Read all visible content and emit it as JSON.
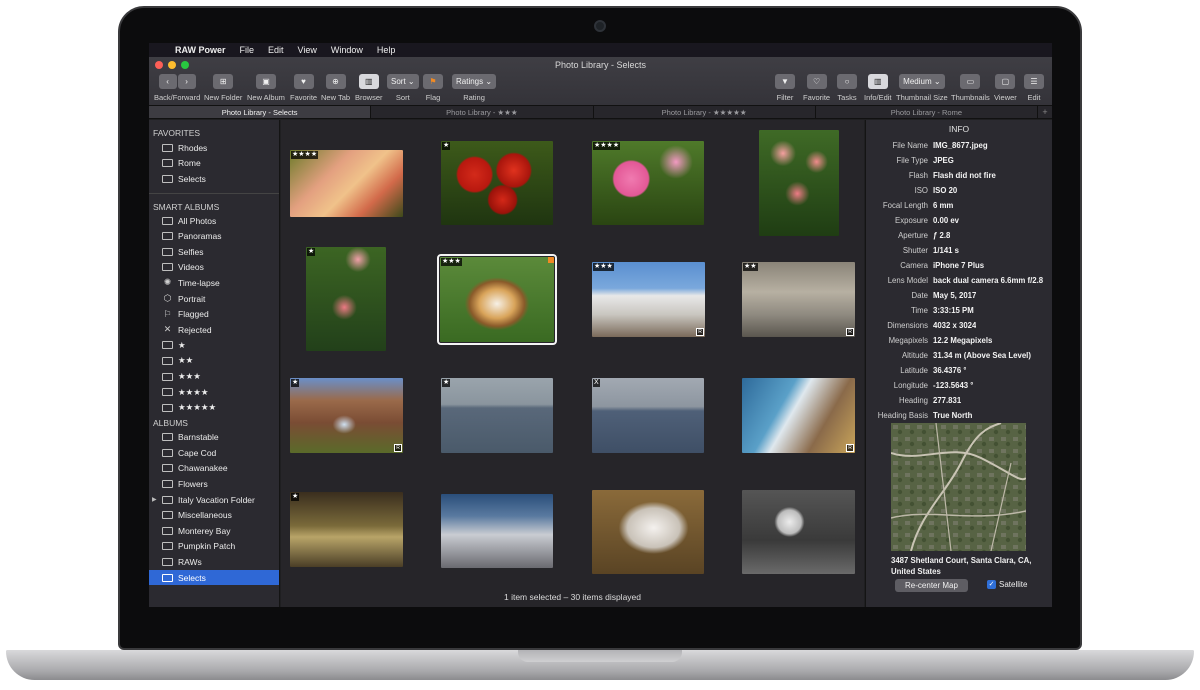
{
  "menubar": {
    "apple": "",
    "app_name": "RAW Power",
    "items": [
      "File",
      "Edit",
      "View",
      "Window",
      "Help"
    ]
  },
  "window": {
    "title": "Photo Library - Selects"
  },
  "toolbar": {
    "back_forward": "Back/Forward",
    "new_folder": "New Folder",
    "new_album": "New Album",
    "favorite": "Favorite",
    "new_tab": "New Tab",
    "browser": "Browser",
    "sort_value": "Sort",
    "sort": "Sort",
    "flag": "Flag",
    "rating_value": "Ratings",
    "rating": "Rating",
    "filter": "Filter",
    "favorite_right": "Favorite",
    "tasks": "Tasks",
    "info_edit": "Info/Edit",
    "thumb_size_value": "Medium",
    "thumbnail_size": "Thumbnail Size",
    "thumbnails": "Thumbnails",
    "viewer": "Viewer",
    "edit": "Edit"
  },
  "tabs": [
    {
      "label": "Photo Library - Selects"
    },
    {
      "label": "Photo Library - ★★★"
    },
    {
      "label": "Photo Library - ★★★★★"
    },
    {
      "label": "Photo Library - Rome"
    }
  ],
  "sidebar": {
    "favorites_header": "FAVORITES",
    "favorites": [
      "Rhodes",
      "Rome",
      "Selects"
    ],
    "smart_header": "SMART ALBUMS",
    "smart": [
      "All Photos",
      "Panoramas",
      "Selfies",
      "Videos",
      "Time-lapse",
      "Portrait",
      "Flagged",
      "Rejected",
      "★",
      "★★",
      "★★★",
      "★★★★",
      "★★★★★"
    ],
    "albums_header": "ALBUMS",
    "albums": [
      "Barnstable",
      "Cape Cod",
      "Chawanakee",
      "Flowers",
      "Italy Vacation Folder",
      "Miscellaneous",
      "Monterey Bay",
      "Pumpkin Patch",
      "RAWs",
      "Selects"
    ]
  },
  "grid": {
    "thumb_badges": [
      "★★★★",
      "★",
      "★★★★",
      "",
      "★",
      "★★★",
      "★★★",
      "★★",
      "★",
      "★",
      "X",
      "",
      "★",
      "",
      "",
      ""
    ],
    "raw_label": "R",
    "status": "1 item selected – 30 items displayed"
  },
  "info": {
    "title": "INFO",
    "rows": [
      {
        "k": "File Name",
        "v": "IMG_8677.jpeg"
      },
      {
        "k": "File Type",
        "v": "JPEG"
      },
      {
        "k": "Flash",
        "v": "Flash did not fire"
      },
      {
        "k": "ISO",
        "v": "ISO 20"
      },
      {
        "k": "Focal Length",
        "v": "6 mm"
      },
      {
        "k": "Exposure",
        "v": "0.00 ev"
      },
      {
        "k": "Aperture",
        "v": "ƒ 2.8"
      },
      {
        "k": "Shutter",
        "v": "1/141 s"
      },
      {
        "k": "Camera",
        "v": "iPhone 7 Plus"
      },
      {
        "k": "Lens Model",
        "v": "back dual camera 6.6mm f/2.8"
      },
      {
        "k": "Date",
        "v": "May 5, 2017"
      },
      {
        "k": "Time",
        "v": "3:33:15 PM"
      },
      {
        "k": "Dimensions",
        "v": "4032 x 3024"
      },
      {
        "k": "Megapixels",
        "v": "12.2 Megapixels"
      },
      {
        "k": "Altitude",
        "v": "31.34 m (Above Sea Level)"
      },
      {
        "k": "Latitude",
        "v": "36.4376 °"
      },
      {
        "k": "Longitude",
        "v": "-123.5643 °"
      },
      {
        "k": "Heading",
        "v": "277.831"
      },
      {
        "k": "Heading Basis",
        "v": "True North"
      }
    ],
    "address": "3487 Shetland Court, Santa Clara, CA, United States",
    "recenter": "Re-center Map",
    "satellite": "Satellite"
  },
  "colors": {
    "accent": "#2f68d6",
    "traffic_close": "#fc5f57",
    "traffic_min": "#fdbc2e",
    "traffic_max": "#28c840"
  }
}
